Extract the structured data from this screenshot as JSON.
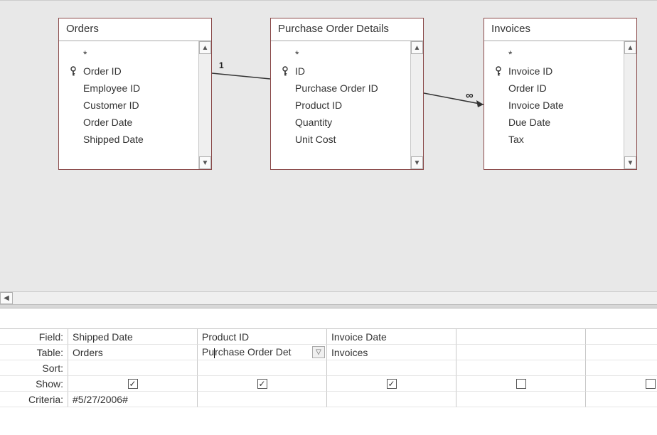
{
  "tables": [
    {
      "title": "Orders",
      "fields": [
        {
          "label": "*",
          "pk": false
        },
        {
          "label": "Order ID",
          "pk": true
        },
        {
          "label": "Employee ID",
          "pk": false
        },
        {
          "label": "Customer ID",
          "pk": false
        },
        {
          "label": "Order Date",
          "pk": false
        },
        {
          "label": "Shipped Date",
          "pk": false
        }
      ]
    },
    {
      "title": "Purchase Order Details",
      "fields": [
        {
          "label": "*",
          "pk": false
        },
        {
          "label": "ID",
          "pk": true
        },
        {
          "label": "Purchase Order ID",
          "pk": false
        },
        {
          "label": "Product ID",
          "pk": false
        },
        {
          "label": "Quantity",
          "pk": false
        },
        {
          "label": "Unit Cost",
          "pk": false
        }
      ]
    },
    {
      "title": "Invoices",
      "fields": [
        {
          "label": "*",
          "pk": false
        },
        {
          "label": "Invoice ID",
          "pk": true
        },
        {
          "label": "Order ID",
          "pk": false
        },
        {
          "label": "Invoice Date",
          "pk": false
        },
        {
          "label": "Due Date",
          "pk": false
        },
        {
          "label": "Tax",
          "pk": false
        }
      ]
    }
  ],
  "joins": [
    {
      "left_label": "1",
      "right_label": ""
    },
    {
      "left_label": "",
      "right_label": "∞"
    }
  ],
  "grid": {
    "row_labels": {
      "field": "Field:",
      "table": "Table:",
      "sort": "Sort:",
      "show": "Show:",
      "criteria": "Criteria:"
    },
    "columns": [
      {
        "field": "Shipped Date",
        "table": "Orders",
        "sort": "",
        "show": true,
        "criteria": "#5/27/2006#",
        "active": false
      },
      {
        "field": "Product ID",
        "table": "Purchase Order Deta",
        "sort": "",
        "show": true,
        "criteria": "",
        "active": true
      },
      {
        "field": "Invoice Date",
        "table": "Invoices",
        "sort": "",
        "show": true,
        "criteria": "",
        "active": false
      },
      {
        "field": "",
        "table": "",
        "sort": "",
        "show": false,
        "criteria": "",
        "active": false
      },
      {
        "field": "",
        "table": "",
        "sort": "",
        "show": false,
        "criteria": "",
        "active": false
      },
      {
        "field": "",
        "table": "",
        "sort": "",
        "show": false,
        "criteria": "",
        "active": false
      }
    ]
  }
}
